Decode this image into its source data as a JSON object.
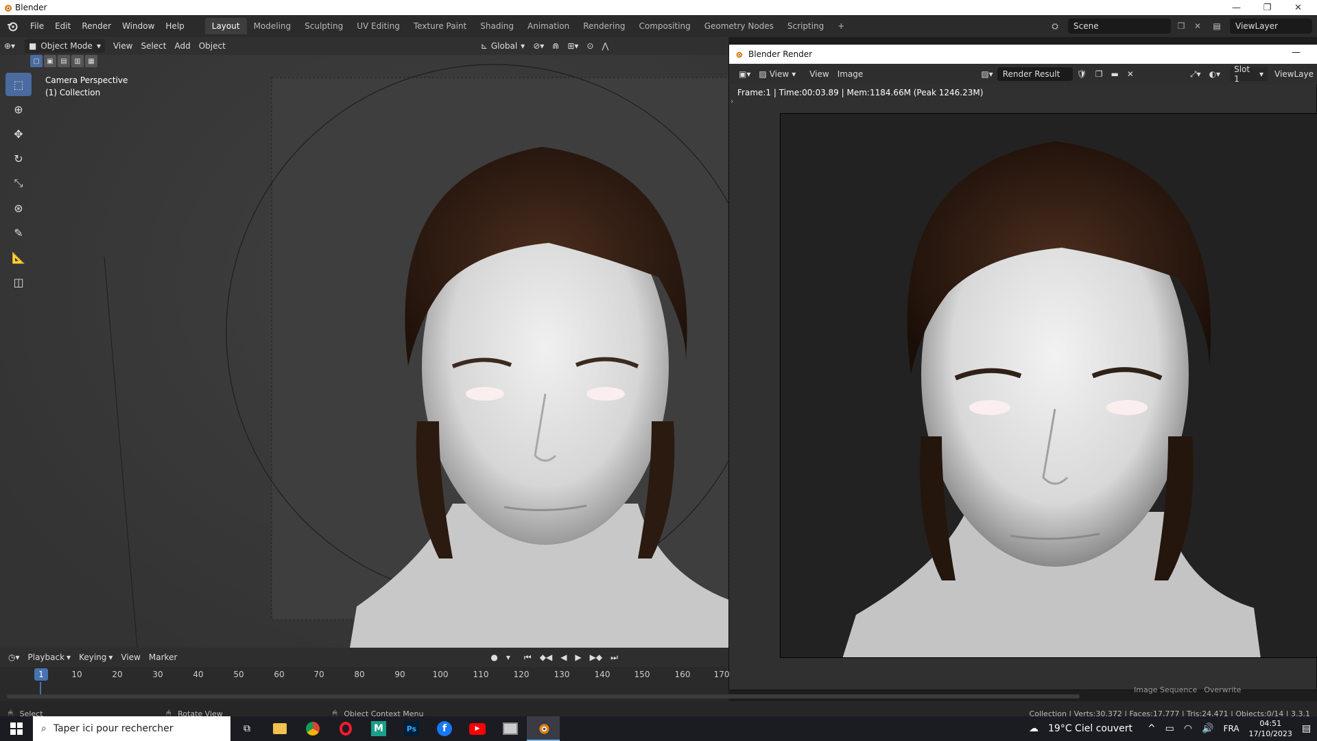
{
  "window": {
    "title": "Blender"
  },
  "menu": [
    "File",
    "Edit",
    "Render",
    "Window",
    "Help"
  ],
  "workspaces": [
    "Layout",
    "Modeling",
    "Sculpting",
    "UV Editing",
    "Texture Paint",
    "Shading",
    "Animation",
    "Rendering",
    "Compositing",
    "Geometry Nodes",
    "Scripting"
  ],
  "active_workspace": "Layout",
  "scene": {
    "name": "Scene",
    "viewlayer": "ViewLayer"
  },
  "viewport": {
    "mode": "Object Mode",
    "menus": [
      "View",
      "Select",
      "Add",
      "Object"
    ],
    "transform_orientation": "Global",
    "overlay_line1": "Camera Perspective",
    "overlay_line2": "(1) Collection"
  },
  "render_window": {
    "title": "Blender Render",
    "view_label": "View",
    "menus": [
      "View",
      "Image"
    ],
    "image_name": "Render Result",
    "slot": "Slot 1",
    "viewlayer": "ViewLaye",
    "info": "Frame:1 | Time:00:03.89 | Mem:1184.66M (Peak 1246.23M)",
    "hidden_labels": [
      "Image Sequence",
      "Overwrite"
    ]
  },
  "timeline": {
    "menus": [
      "Playback",
      "Keying",
      "View",
      "Marker"
    ],
    "current_frame": "1",
    "ticks": [
      "10",
      "20",
      "30",
      "40",
      "50",
      "60",
      "70",
      "80",
      "90",
      "100",
      "110",
      "120",
      "130",
      "140",
      "150",
      "160",
      "170"
    ]
  },
  "statusbar": {
    "select": "Select",
    "rotate": "Rotate View",
    "context": "Object Context Menu",
    "stats": "Collection | Verts:30,372 | Faces:17,777 | Tris:24,471 | Objects:0/14 | 3.3.1"
  },
  "taskbar": {
    "search_placeholder": "Taper ici pour rechercher",
    "weather": "19°C  Ciel couvert",
    "lang": "FRA",
    "time": "04:51",
    "date": "17/10/2023"
  },
  "colors": {
    "accent": "#4a6aa0",
    "active_frame": "#4772b3"
  }
}
